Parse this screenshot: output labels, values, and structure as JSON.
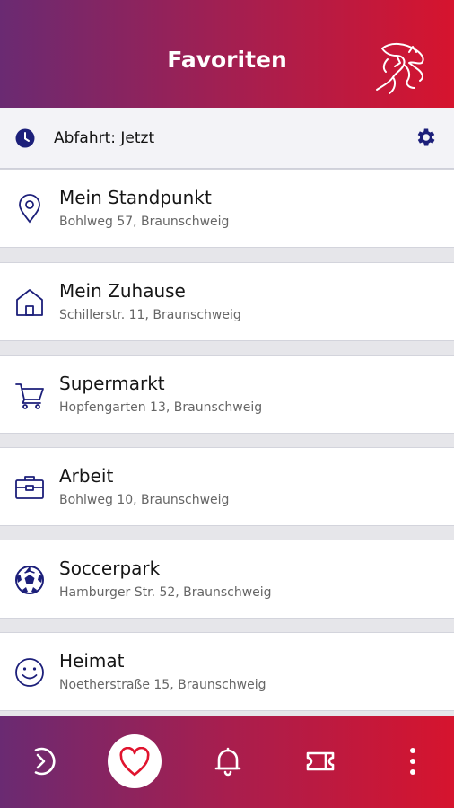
{
  "header": {
    "title": "Favoriten",
    "logo_icon": "lion-logo-icon",
    "colors": {
      "gradient_start": "#6a2a72",
      "gradient_end": "#d6142e"
    }
  },
  "departure": {
    "icon": "clock-icon",
    "label": "Abfahrt: Jetzt",
    "settings_icon": "gear-icon",
    "accent": "#1c1f7a"
  },
  "favorites": [
    {
      "name": "Mein Standpunkt",
      "address": "Bohlweg 57, Braunschweig",
      "icon": "location-pin-icon"
    },
    {
      "name": "Mein Zuhause",
      "address": "Schillerstr. 11, Braunschweig",
      "icon": "home-icon"
    },
    {
      "name": "Supermarkt",
      "address": "Hopfengarten 13, Braunschweig",
      "icon": "shopping-cart-icon"
    },
    {
      "name": "Arbeit",
      "address": "Bohlweg 10, Braunschweig",
      "icon": "briefcase-icon"
    },
    {
      "name": "Soccerpark",
      "address": "Hamburger Str. 52, Braunschweig",
      "icon": "soccer-ball-icon"
    },
    {
      "name": "Heimat",
      "address": "Noetherstraße 15, Braunschweig",
      "icon": "smiley-icon"
    }
  ],
  "bottom_nav": {
    "items": [
      {
        "icon": "journey-arrow-icon",
        "active": false
      },
      {
        "icon": "heart-icon",
        "active": true
      },
      {
        "icon": "bell-icon",
        "active": false
      },
      {
        "icon": "ticket-icon",
        "active": false
      },
      {
        "icon": "more-vertical-icon",
        "active": false
      }
    ],
    "active_color": "#e0142e"
  }
}
